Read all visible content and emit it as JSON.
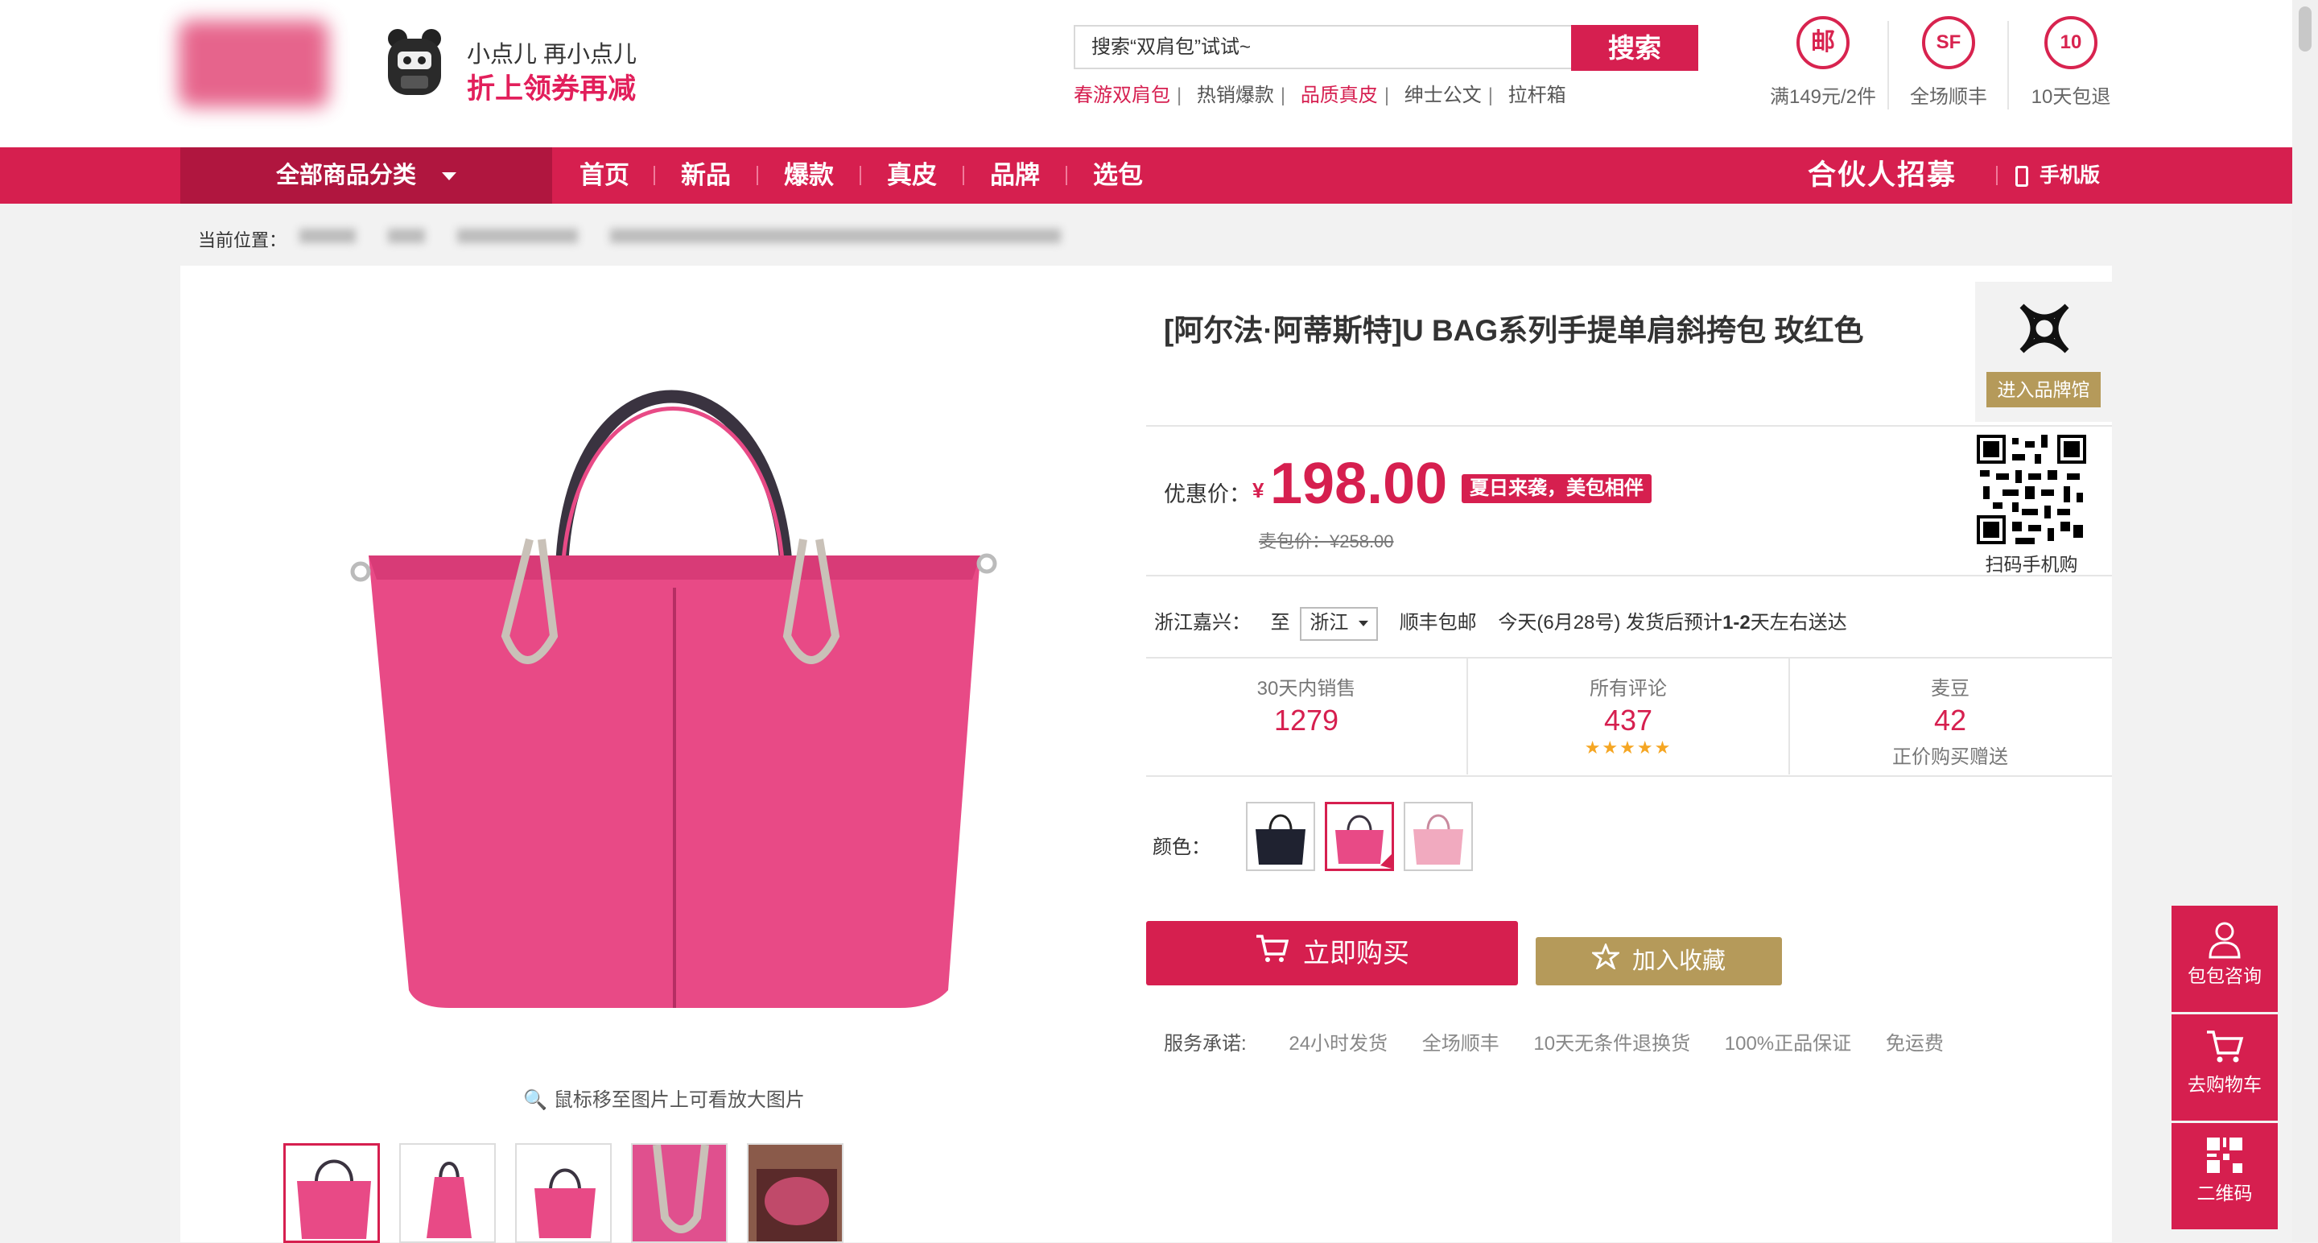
{
  "header": {
    "promo_line1": "小点儿 再小点儿",
    "promo_line2": "折上领券再减",
    "search_value": "搜索“双肩包”试试~",
    "search_button": "搜索",
    "hotwords": [
      {
        "text": "春游双肩包",
        "red": true
      },
      {
        "text": "热销爆款",
        "red": false
      },
      {
        "text": "品质真皮",
        "red": true
      },
      {
        "text": "绅士公文",
        "red": false
      },
      {
        "text": "拉杆箱",
        "red": false
      }
    ],
    "services": [
      {
        "glyph": "邮",
        "label": "满149元/2件",
        "icon": "mail-icon"
      },
      {
        "glyph": "SF",
        "label": "全场顺丰",
        "icon": "sf-express-icon"
      },
      {
        "glyph": "10",
        "label": "10天包退",
        "icon": "return-icon"
      }
    ]
  },
  "nav": {
    "category": "全部商品分类",
    "items": [
      "首页",
      "新品",
      "爆款",
      "真皮",
      "品牌",
      "选包"
    ],
    "partner": "合伙人招募",
    "mobile": "手机版"
  },
  "breadcrumb": {
    "label": "当前位置："
  },
  "product": {
    "title": "[阿尔法·阿蒂斯特]U BAG系列手提单肩斜挎包 玫红色",
    "brand_button": "进入品牌馆",
    "price_label": "优惠价：",
    "currency": "¥",
    "price": "198.00",
    "price_tag": "夏日来袭，美包相伴",
    "original_price": "麦包价：¥258.00",
    "qr_label": "扫码手机购",
    "zoom_hint": "鼠标移至图片上可看放大图片",
    "shipping": {
      "from": "浙江嘉兴：",
      "to_label": "至",
      "to_value": "浙江",
      "method": "顺丰包邮",
      "eta_prefix": "今天(6月28号) 发货后预计",
      "eta_bold": "1-2",
      "eta_suffix": "天左右送达"
    },
    "stats": [
      {
        "label": "30天内销售",
        "value": "1279",
        "sub": ""
      },
      {
        "label": "所有评论",
        "value": "437",
        "sub": "★★★★★"
      },
      {
        "label": "麦豆",
        "value": "42",
        "sub": "正价购买赠送"
      }
    ],
    "rating_stars": 5,
    "color_label": "颜色：",
    "buy_button": "立即购买",
    "fav_button": "加入收藏",
    "promise_label": "服务承诺:",
    "promises": [
      "24小时发货",
      "全场顺丰",
      "10天无条件退换货",
      "100%正品保证",
      "免运费"
    ]
  },
  "sidebar": {
    "items": [
      "包包咨询",
      "去购物车",
      "二维码"
    ]
  },
  "colors": {
    "accent": "#d61f4f",
    "accent_dark": "#b0163f",
    "gold": "#b59a5a",
    "bag_pink": "#e84a86"
  }
}
